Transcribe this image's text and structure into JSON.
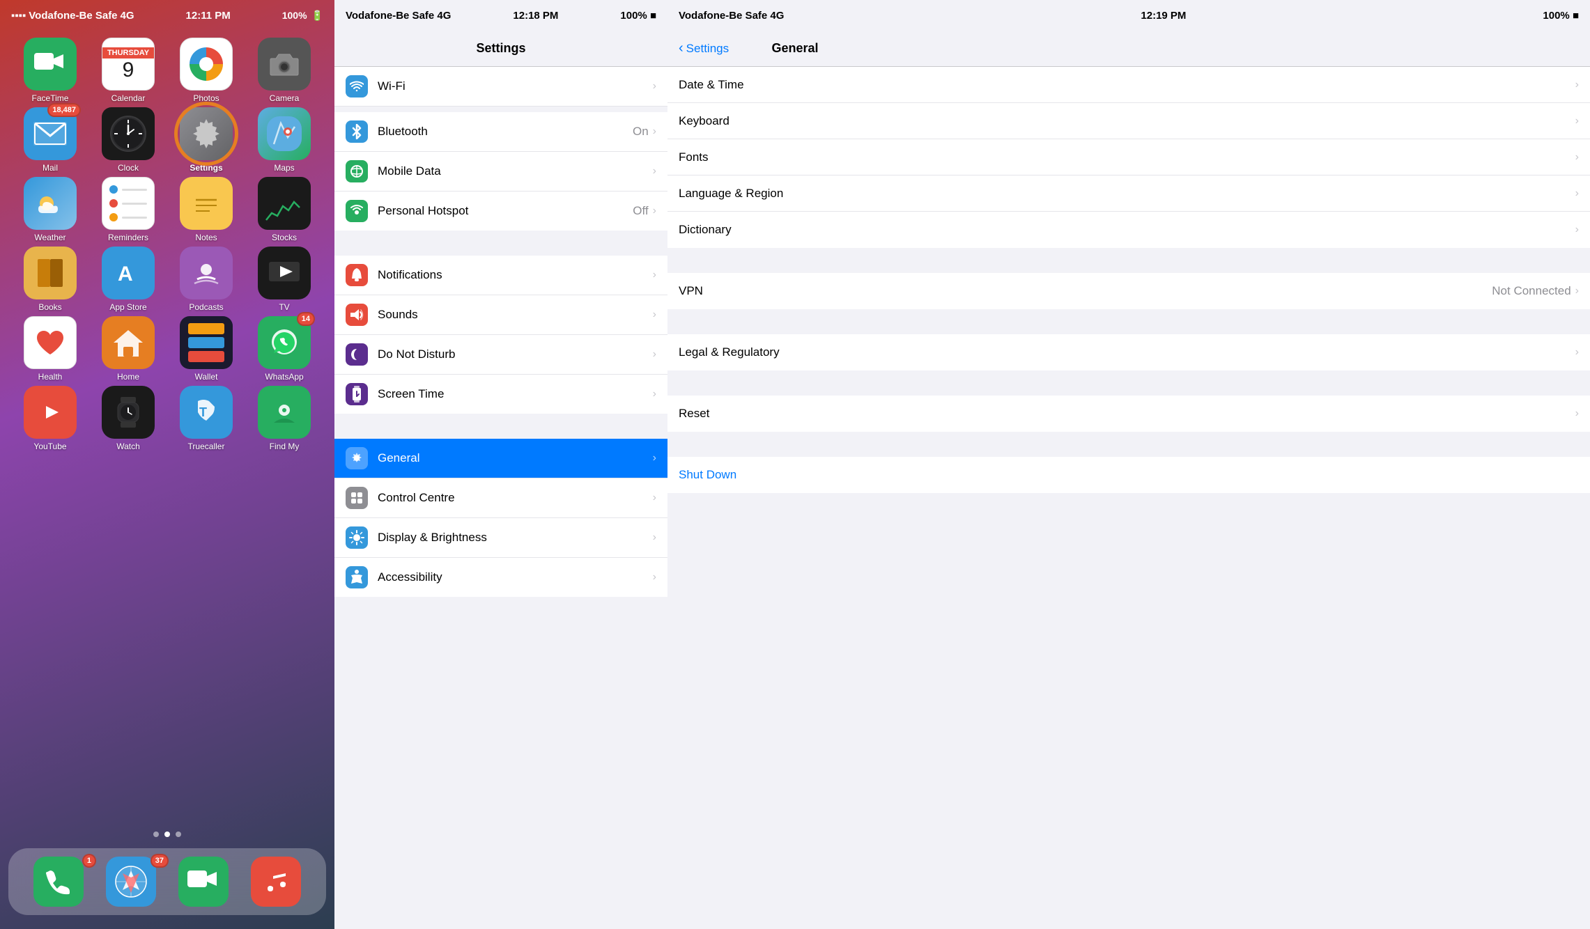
{
  "panel1": {
    "statusBar": {
      "carrier": "Vodafone-Be Safe",
      "network": "4G",
      "time": "12:11 PM",
      "battery": "100%"
    },
    "rows": [
      [
        {
          "id": "facetime",
          "label": "FaceTime",
          "emoji": "📹",
          "bg": "#27ae60",
          "badge": null
        },
        {
          "id": "calendar",
          "label": "Calendar",
          "emoji": "cal",
          "bg": "special",
          "badge": null
        },
        {
          "id": "photos",
          "label": "Photos",
          "emoji": "🌈",
          "bg": "#fff",
          "badge": null
        },
        {
          "id": "camera",
          "label": "Camera",
          "emoji": "📷",
          "bg": "#555",
          "badge": null
        }
      ],
      [
        {
          "id": "mail",
          "label": "Mail",
          "emoji": "✉️",
          "bg": "#3498db",
          "badge": "18,487"
        },
        {
          "id": "clock",
          "label": "Clock",
          "emoji": "clock",
          "bg": "special",
          "badge": null
        },
        {
          "id": "settings",
          "label": "Settings",
          "emoji": "⚙️",
          "bg": "gray",
          "badge": null,
          "highlighted": true
        },
        {
          "id": "maps",
          "label": "Maps",
          "emoji": "🗺️",
          "bg": "special",
          "badge": null
        }
      ],
      [
        {
          "id": "weather",
          "label": "Weather",
          "emoji": "⛅",
          "bg": "#3498db",
          "badge": null
        },
        {
          "id": "reminders",
          "label": "Reminders",
          "emoji": "rem",
          "bg": "special",
          "badge": null
        },
        {
          "id": "notes",
          "label": "Notes",
          "emoji": "📝",
          "bg": "#f9c74f",
          "badge": null
        },
        {
          "id": "stocks",
          "label": "Stocks",
          "emoji": "📈",
          "bg": "#1a1a1a",
          "badge": null
        }
      ],
      [
        {
          "id": "books",
          "label": "Books",
          "emoji": "📚",
          "bg": "#e8b44c",
          "badge": null
        },
        {
          "id": "appstore",
          "label": "App Store",
          "emoji": "🅰️",
          "bg": "#3498db",
          "badge": null
        },
        {
          "id": "podcasts",
          "label": "Podcasts",
          "emoji": "🎙️",
          "bg": "#9b59b6",
          "badge": null
        },
        {
          "id": "tv",
          "label": "TV",
          "emoji": "📺",
          "bg": "#1a1a1a",
          "badge": null
        }
      ],
      [
        {
          "id": "health",
          "label": "Health",
          "emoji": "❤️",
          "bg": "#fff",
          "badge": null
        },
        {
          "id": "home",
          "label": "Home",
          "emoji": "🏠",
          "bg": "#e67e22",
          "badge": null
        },
        {
          "id": "wallet",
          "label": "Wallet",
          "emoji": "wallet",
          "bg": "#1a1a2e",
          "badge": null
        },
        {
          "id": "whatsapp",
          "label": "WhatsApp",
          "emoji": "💬",
          "bg": "#27ae60",
          "badge": "14"
        }
      ],
      [
        {
          "id": "youtube",
          "label": "YouTube",
          "emoji": "▶️",
          "bg": "#e74c3c",
          "badge": null
        },
        {
          "id": "watch",
          "label": "Watch",
          "emoji": "⌚",
          "bg": "#1a1a1a",
          "badge": null
        },
        {
          "id": "truecaller",
          "label": "Truecaller",
          "emoji": "📞",
          "bg": "#3498db",
          "badge": null
        },
        {
          "id": "findmy",
          "label": "Find My",
          "emoji": "📍",
          "bg": "#27ae60",
          "badge": null
        }
      ]
    ],
    "dots": [
      false,
      true,
      false
    ],
    "dock": [
      {
        "id": "phone",
        "label": "Phone",
        "emoji": "📞",
        "bg": "#27ae60",
        "badge": "1"
      },
      {
        "id": "safari",
        "label": "Safari",
        "emoji": "🧭",
        "bg": "#3498db",
        "badge": "37"
      },
      {
        "id": "facetime2",
        "label": "FaceTime",
        "emoji": "📹",
        "bg": "#27ae60",
        "badge": null
      },
      {
        "id": "music",
        "label": "Music",
        "emoji": "🎵",
        "bg": "#e74c3c",
        "badge": null
      }
    ]
  },
  "panel2": {
    "statusBar": {
      "carrier": "Vodafone-Be Safe",
      "network": "4G",
      "time": "12:18 PM",
      "battery": "100%"
    },
    "title": "Settings",
    "sections": [
      {
        "items": [
          {
            "id": "bluetooth",
            "label": "Bluetooth",
            "value": "On",
            "iconBg": "#3498db",
            "icon": "bluetooth"
          },
          {
            "id": "mobiledata",
            "label": "Mobile Data",
            "value": "",
            "iconBg": "#27ae60",
            "icon": "signal"
          },
          {
            "id": "hotspot",
            "label": "Personal Hotspot",
            "value": "Off",
            "iconBg": "#27ae60",
            "icon": "hotspot"
          }
        ]
      },
      {
        "items": [
          {
            "id": "notifications",
            "label": "Notifications",
            "value": "",
            "iconBg": "#e74c3c",
            "icon": "bell"
          },
          {
            "id": "sounds",
            "label": "Sounds",
            "value": "",
            "iconBg": "#e74c3c",
            "icon": "speaker"
          },
          {
            "id": "donotdisturb",
            "label": "Do Not Disturb",
            "value": "",
            "iconBg": "#5b2d8e",
            "icon": "moon"
          },
          {
            "id": "screentime",
            "label": "Screen Time",
            "value": "",
            "iconBg": "#5b2d8e",
            "icon": "hourglass"
          }
        ]
      },
      {
        "items": [
          {
            "id": "general",
            "label": "General",
            "value": "",
            "iconBg": "#8e8e93",
            "icon": "gear",
            "selected": true
          },
          {
            "id": "controlcentre",
            "label": "Control Centre",
            "value": "",
            "iconBg": "#8e8e93",
            "icon": "sliders"
          },
          {
            "id": "displaybrightness",
            "label": "Display & Brightness",
            "value": "",
            "iconBg": "#3498db",
            "icon": "sun"
          },
          {
            "id": "accessibility",
            "label": "Accessibility",
            "value": "",
            "iconBg": "#3498db",
            "icon": "person"
          }
        ]
      }
    ]
  },
  "panel3": {
    "statusBar": {
      "carrier": "Vodafone-Be Safe",
      "network": "4G",
      "time": "12:19 PM",
      "battery": "100%"
    },
    "backLabel": "Settings",
    "title": "General",
    "items": [
      {
        "id": "datetime",
        "label": "Date & Time",
        "value": ""
      },
      {
        "id": "keyboard",
        "label": "Keyboard",
        "value": ""
      },
      {
        "id": "fonts",
        "label": "Fonts",
        "value": ""
      },
      {
        "id": "languageregion",
        "label": "Language & Region",
        "value": ""
      },
      {
        "id": "dictionary",
        "label": "Dictionary",
        "value": ""
      }
    ],
    "section2": [
      {
        "id": "vpn",
        "label": "VPN",
        "value": "Not Connected"
      }
    ],
    "section3": [
      {
        "id": "legalregulatory",
        "label": "Legal & Regulatory",
        "value": ""
      }
    ],
    "section4": [
      {
        "id": "reset",
        "label": "Reset",
        "value": ""
      }
    ],
    "section5": [
      {
        "id": "shutdown",
        "label": "Shut Down",
        "value": "",
        "special": "shutdown"
      }
    ]
  },
  "icons": {
    "bluetooth": "ᛒ",
    "signal": "📶",
    "chevron": "›",
    "back": "‹"
  }
}
